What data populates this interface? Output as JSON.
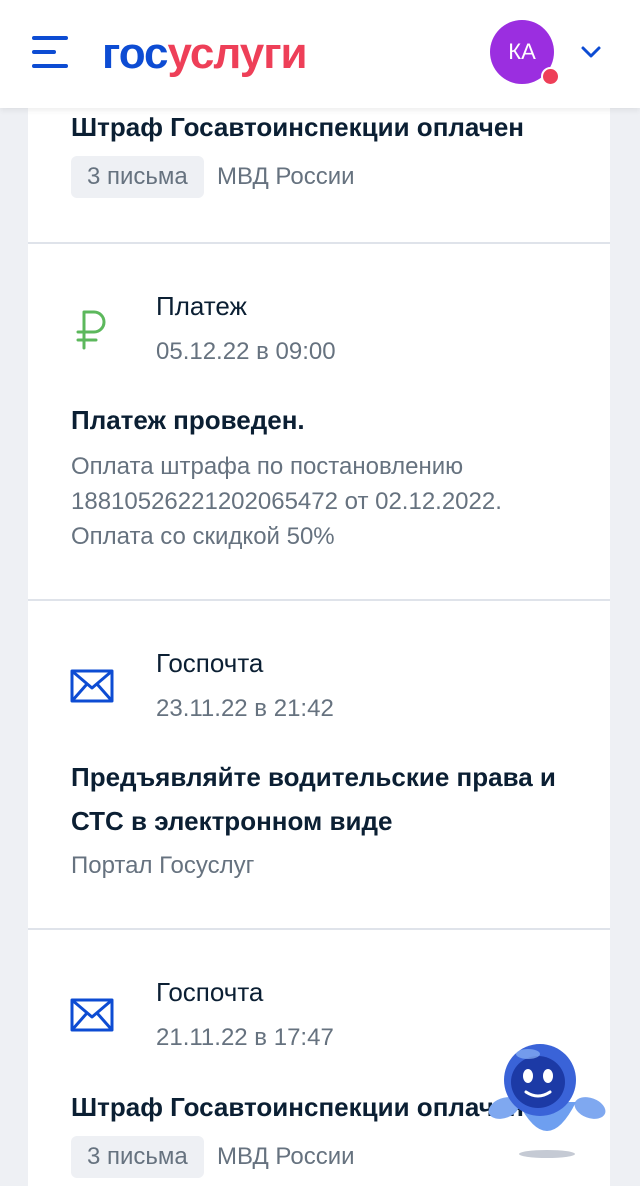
{
  "header": {
    "logo_part1": "гос",
    "logo_part2": "услуги",
    "avatar_initials": "КА"
  },
  "feed": [
    {
      "title": "Штраф Госавтоинспекции оплачен",
      "badge": "3 письма",
      "sender": "МВД России"
    },
    {
      "category": "Платеж",
      "date": "05.12.22 в 09:00",
      "title": "Платеж проведен.",
      "description": "Оплата штрафа по постановлению 18810526221202065472 от 02.12.2022. Оплата со скидкой 50%",
      "icon": "ruble-icon"
    },
    {
      "category": "Госпочта",
      "date": "23.11.22 в 21:42",
      "title_line1": "Предъявляйте водительские права и",
      "title_line2": "СТС в электронном виде",
      "sender": "Портал Госуслуг",
      "icon": "envelope-icon"
    },
    {
      "category": "Госпочта",
      "date": "21.11.22 в 17:47",
      "title": "Штраф Госавтоинспекции оплачен",
      "badge": "3 письма",
      "sender": "МВД России",
      "icon": "envelope-icon"
    }
  ],
  "colors": {
    "brand_blue": "#0d4cd3",
    "brand_red": "#ee3f58",
    "avatar_purple": "#9b2ee0",
    "ruble_green": "#5cb85c"
  }
}
